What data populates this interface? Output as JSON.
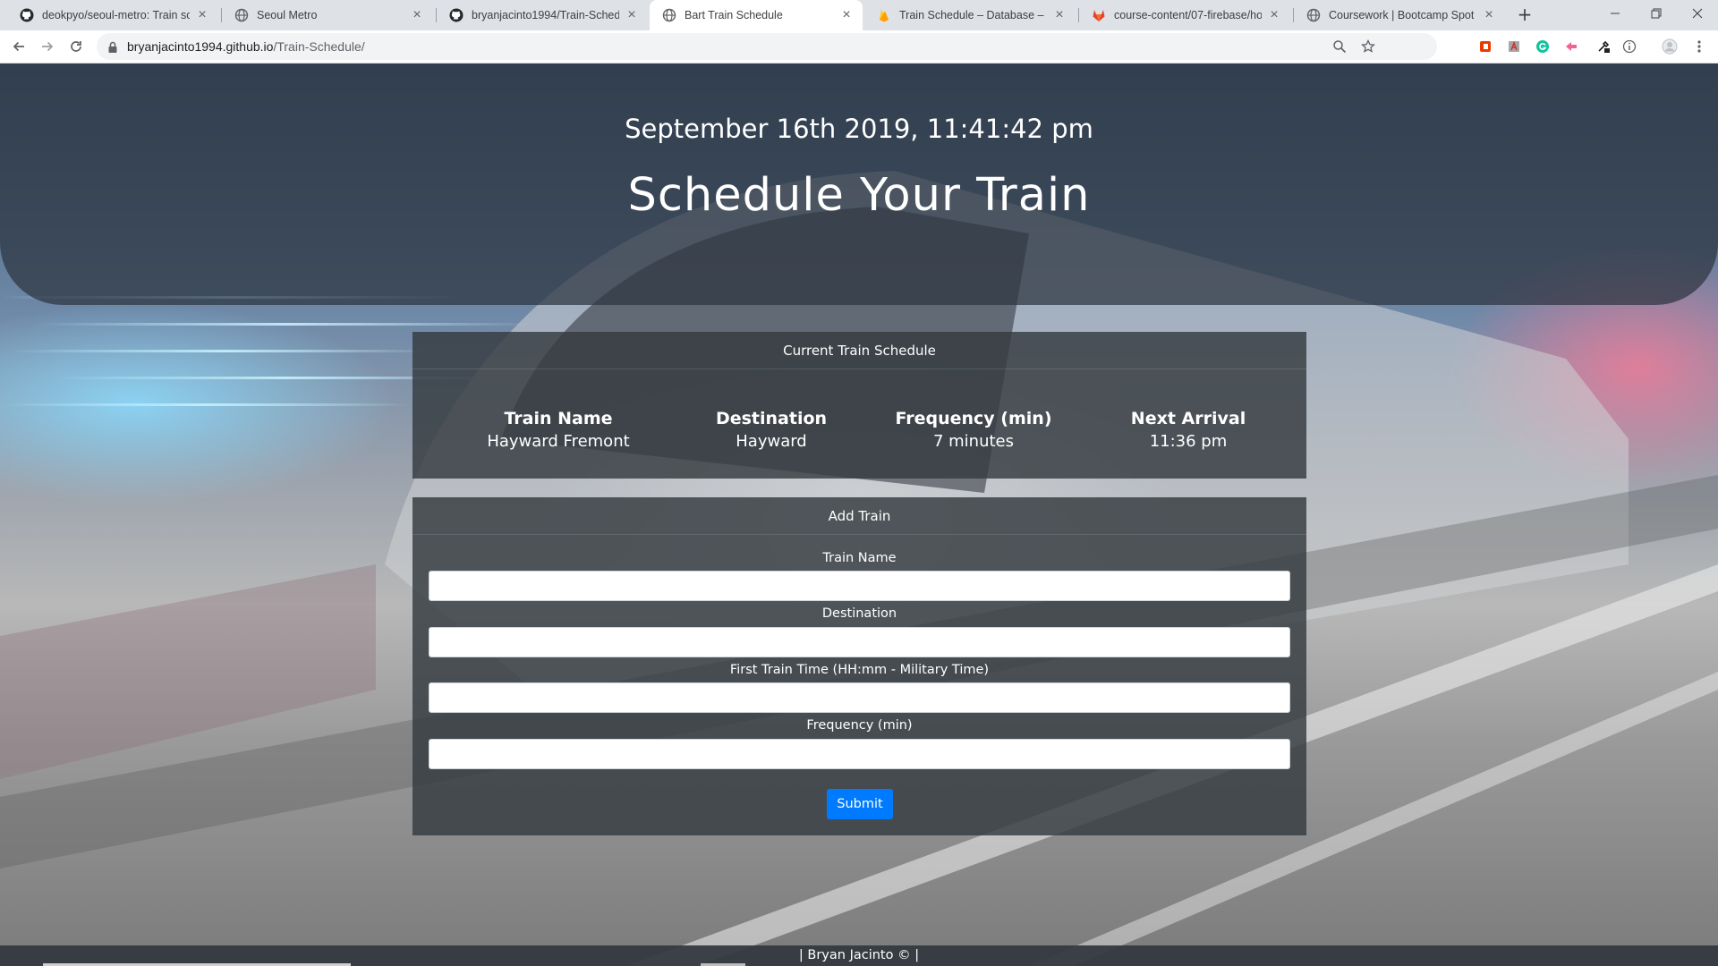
{
  "browser": {
    "tabs": [
      {
        "title": "deokpyo/seoul-metro: Train sche",
        "icon": "github-icon"
      },
      {
        "title": "Seoul Metro",
        "icon": "globe-icon"
      },
      {
        "title": "bryanjacinto1994/Train-Schedule",
        "icon": "github-icon"
      },
      {
        "title": "Bart Train Schedule",
        "icon": "globe-icon",
        "active": true
      },
      {
        "title": "Train Schedule – Database – Fireb",
        "icon": "firebase-icon"
      },
      {
        "title": "course-content/07-firebase/hom",
        "icon": "gitlab-icon"
      },
      {
        "title": "Coursework | Bootcamp Spot",
        "icon": "globe-icon"
      }
    ],
    "new_tab_label": "+",
    "url_host": "bryanjacinto1994.github.io",
    "url_path": "/Train-Schedule/"
  },
  "page": {
    "datetime": "September 16th 2019, 11:41:42 pm",
    "title": "Schedule Your Train",
    "schedule": {
      "heading": "Current Train Schedule",
      "columns": [
        "Train Name",
        "Destination",
        "Frequency (min)",
        "Next Arrival"
      ],
      "rows": [
        [
          "Hayward Fremont",
          "Hayward",
          "7 minutes",
          "11:36 pm"
        ]
      ]
    },
    "add_train": {
      "heading": "Add Train",
      "fields": [
        {
          "label": "Train Name",
          "value": ""
        },
        {
          "label": "Destination",
          "value": ""
        },
        {
          "label": "First Train Time (HH:mm - Military Time)",
          "value": ""
        },
        {
          "label": "Frequency (min)",
          "value": ""
        }
      ],
      "submit_label": "Submit"
    },
    "footer": "| Bryan Jacinto © |"
  },
  "colors": {
    "header_band": "#2c3440",
    "panel": "#343a40",
    "submit": "#007bff",
    "tab_strip": "#dee1e6"
  }
}
